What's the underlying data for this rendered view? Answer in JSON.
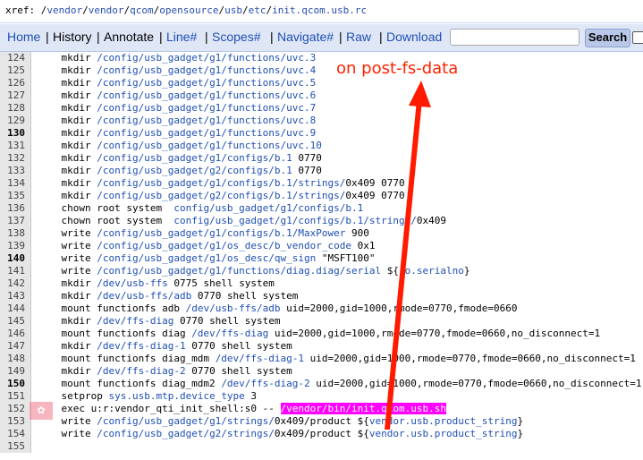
{
  "xref": {
    "prefix": "xref: ",
    "parts": [
      "/",
      "vendor",
      "/",
      "vendor",
      "/",
      "qcom",
      "/",
      "opensource",
      "/",
      "usb",
      "/",
      "etc",
      "/",
      "init.qcom.usb.rc"
    ]
  },
  "nav": {
    "home": "Home",
    "history": "History",
    "annotate": "Annotate",
    "line": "Line#",
    "scopes": "Scopes#",
    "navigate": "Navigate#",
    "raw": "Raw",
    "download": "Download",
    "search_button": "Search",
    "search_value": ""
  },
  "annotation": "on post-fs-data",
  "lines": [
    {
      "n": "124",
      "bold": false,
      "segs": [
        {
          "t": "    mkdir "
        },
        {
          "t": "/config/usb_gadget/g1/functions/uvc.3",
          "c": "p"
        }
      ]
    },
    {
      "n": "125",
      "bold": false,
      "segs": [
        {
          "t": "    mkdir "
        },
        {
          "t": "/config/usb_gadget/g1/functions/uvc.4",
          "c": "p"
        }
      ]
    },
    {
      "n": "126",
      "bold": false,
      "segs": [
        {
          "t": "    mkdir "
        },
        {
          "t": "/config/usb_gadget/g1/functions/uvc.5",
          "c": "p"
        }
      ]
    },
    {
      "n": "127",
      "bold": false,
      "segs": [
        {
          "t": "    mkdir "
        },
        {
          "t": "/config/usb_gadget/g1/functions/uvc.6",
          "c": "p"
        }
      ]
    },
    {
      "n": "128",
      "bold": false,
      "segs": [
        {
          "t": "    mkdir "
        },
        {
          "t": "/config/usb_gadget/g1/functions/uvc.7",
          "c": "p"
        }
      ]
    },
    {
      "n": "129",
      "bold": false,
      "segs": [
        {
          "t": "    mkdir "
        },
        {
          "t": "/config/usb_gadget/g1/functions/uvc.8",
          "c": "p"
        }
      ]
    },
    {
      "n": "130",
      "bold": true,
      "segs": [
        {
          "t": "    mkdir "
        },
        {
          "t": "/config/usb_gadget/g1/functions/uvc.9",
          "c": "p"
        }
      ]
    },
    {
      "n": "131",
      "bold": false,
      "segs": [
        {
          "t": "    mkdir "
        },
        {
          "t": "/config/usb_gadget/g1/functions/uvc.10",
          "c": "p"
        }
      ]
    },
    {
      "n": "132",
      "bold": false,
      "segs": [
        {
          "t": "    mkdir "
        },
        {
          "t": "/config/usb_gadget/g1/configs/b.1",
          "c": "p"
        },
        {
          "t": " 0770"
        }
      ]
    },
    {
      "n": "133",
      "bold": false,
      "segs": [
        {
          "t": "    mkdir "
        },
        {
          "t": "/config/usb_gadget/g2/configs/b.1",
          "c": "p"
        },
        {
          "t": " 0770"
        }
      ]
    },
    {
      "n": "134",
      "bold": false,
      "segs": [
        {
          "t": "    mkdir "
        },
        {
          "t": "/config/usb_gadget/g1/configs/b.1/strings/",
          "c": "p"
        },
        {
          "t": "0x409 0770"
        }
      ]
    },
    {
      "n": "135",
      "bold": false,
      "segs": [
        {
          "t": "    mkdir "
        },
        {
          "t": "/config/usb_gadget/g2/configs/b.1/strings/",
          "c": "p"
        },
        {
          "t": "0x409 0770"
        }
      ]
    },
    {
      "n": "136",
      "bold": false,
      "segs": [
        {
          "t": "    chown root system  "
        },
        {
          "t": "config/usb_gadget/g1/configs/b.1",
          "c": "p"
        }
      ]
    },
    {
      "n": "137",
      "bold": false,
      "segs": [
        {
          "t": "    chown root system  "
        },
        {
          "t": "config/usb_gadget/g1/configs/b.1/strings/",
          "c": "p"
        },
        {
          "t": "0x409"
        }
      ]
    },
    {
      "n": "138",
      "bold": false,
      "segs": [
        {
          "t": "    write "
        },
        {
          "t": "/config/usb_gadget/g1/configs/b.1/MaxPower",
          "c": "p"
        },
        {
          "t": " 900"
        }
      ]
    },
    {
      "n": "139",
      "bold": false,
      "segs": [
        {
          "t": "    write "
        },
        {
          "t": "/config/usb_gadget/g1/os_desc/b_vendor_code",
          "c": "p"
        },
        {
          "t": " 0x1"
        }
      ]
    },
    {
      "n": "140",
      "bold": true,
      "segs": [
        {
          "t": "    write "
        },
        {
          "t": "/config/usb_gadget/g1/os_desc/qw_sign",
          "c": "p"
        },
        {
          "t": " \"MSFT100\""
        }
      ]
    },
    {
      "n": "141",
      "bold": false,
      "segs": [
        {
          "t": "    write "
        },
        {
          "t": "/config/usb_gadget/g1/functions/diag.diag/serial",
          "c": "p"
        },
        {
          "t": " ${"
        },
        {
          "t": "ro.serialno",
          "c": "p"
        },
        {
          "t": "}"
        }
      ]
    },
    {
      "n": "142",
      "bold": false,
      "segs": [
        {
          "t": "    mkdir "
        },
        {
          "t": "/dev/usb-ffs",
          "c": "p"
        },
        {
          "t": " 0775 shell system"
        }
      ]
    },
    {
      "n": "143",
      "bold": false,
      "segs": [
        {
          "t": "    mkdir "
        },
        {
          "t": "/dev/usb-ffs/adb",
          "c": "p"
        },
        {
          "t": " 0770 shell system"
        }
      ]
    },
    {
      "n": "144",
      "bold": false,
      "segs": [
        {
          "t": "    mount functionfs adb "
        },
        {
          "t": "/dev/usb-ffs/adb",
          "c": "p"
        },
        {
          "t": " uid=2000,gid=1000,rmode=0770,fmode=0660"
        }
      ]
    },
    {
      "n": "145",
      "bold": false,
      "segs": [
        {
          "t": "    mkdir "
        },
        {
          "t": "/dev/ffs-diag",
          "c": "p"
        },
        {
          "t": " 0770 shell system"
        }
      ]
    },
    {
      "n": "146",
      "bold": false,
      "segs": [
        {
          "t": "    mount functionfs diag "
        },
        {
          "t": "/dev/ffs-diag",
          "c": "p"
        },
        {
          "t": " uid=2000,gid=1000,rmode=0770,fmode=0660,no_disconnect=1"
        }
      ]
    },
    {
      "n": "147",
      "bold": false,
      "segs": [
        {
          "t": "    mkdir "
        },
        {
          "t": "/dev/ffs-diag-1",
          "c": "p"
        },
        {
          "t": " 0770 shell system"
        }
      ]
    },
    {
      "n": "148",
      "bold": false,
      "segs": [
        {
          "t": "    mount functionfs diag_mdm "
        },
        {
          "t": "/dev/ffs-diag-1",
          "c": "p"
        },
        {
          "t": " uid=2000,gid=1000,rmode=0770,fmode=0660,no_disconnect=1"
        }
      ]
    },
    {
      "n": "149",
      "bold": false,
      "segs": [
        {
          "t": "    mkdir "
        },
        {
          "t": "/dev/ffs-diag-2",
          "c": "p"
        },
        {
          "t": " 0770 shell system"
        }
      ]
    },
    {
      "n": "150",
      "bold": true,
      "segs": [
        {
          "t": "    mount functionfs diag_mdm2 "
        },
        {
          "t": "/dev/ffs-diag-2",
          "c": "p"
        },
        {
          "t": " uid=2000,gid=1000,rmode=0770,fmode=0660,no_disconnect=1"
        }
      ]
    },
    {
      "n": "151",
      "bold": false,
      "segs": [
        {
          "t": "    setprop "
        },
        {
          "t": "sys.usb.mtp.device_type",
          "c": "p"
        },
        {
          "t": " 3"
        }
      ]
    },
    {
      "n": "152",
      "bold": false,
      "segs": [
        {
          "t": "    exec u:r:vendor_qti_init_shell:s0 -- "
        },
        {
          "t": "/vendor/bin/init.qcom.usb.sh",
          "c": "hl"
        }
      ]
    },
    {
      "n": "153",
      "bold": false,
      "segs": [
        {
          "t": "    write "
        },
        {
          "t": "/config/usb_gadget/g1/strings/",
          "c": "p"
        },
        {
          "t": "0x409/product ${"
        },
        {
          "t": "vendor.usb.product_string",
          "c": "p"
        },
        {
          "t": "}"
        }
      ]
    },
    {
      "n": "154",
      "bold": false,
      "segs": [
        {
          "t": "    write "
        },
        {
          "t": "/config/usb_gadget/g2/strings/",
          "c": "p"
        },
        {
          "t": "0x409/product ${"
        },
        {
          "t": "vendor.usb.product_string",
          "c": "p"
        },
        {
          "t": "}"
        }
      ]
    },
    {
      "n": "155",
      "bold": false,
      "segs": [
        {
          "t": ""
        }
      ]
    }
  ]
}
